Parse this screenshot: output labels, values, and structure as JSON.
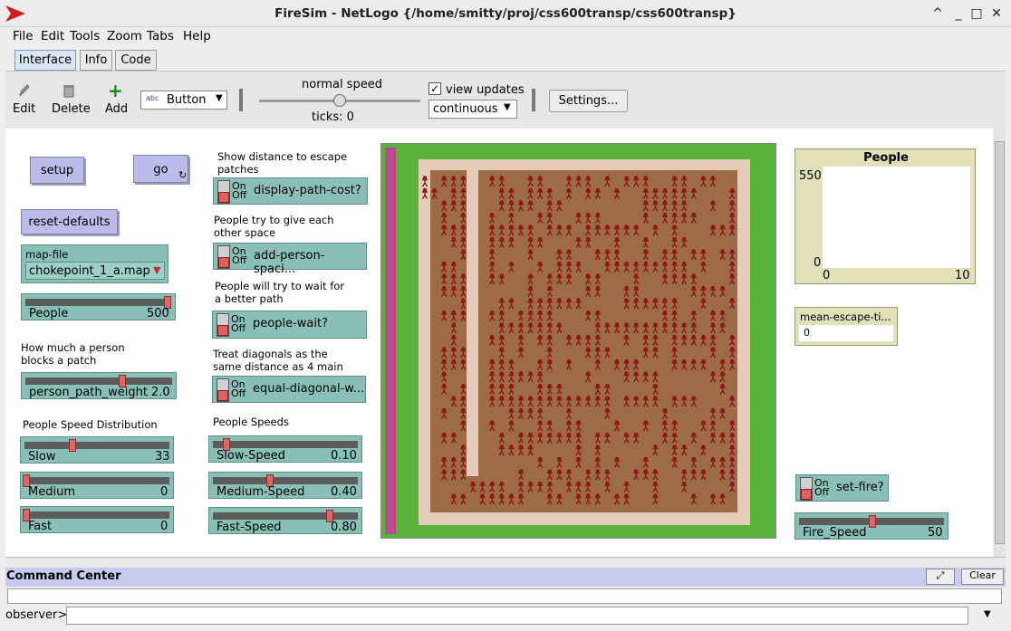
{
  "window": {
    "title": "FireSim - NetLogo {/home/smitty/proj/css600transp/css600transp}",
    "controls": [
      "^",
      "_",
      "□",
      "✕"
    ]
  },
  "menu": [
    "File",
    "Edit",
    "Tools",
    "Zoom",
    "Tabs",
    "Help"
  ],
  "tabs": [
    "Interface",
    "Info",
    "Code"
  ],
  "toolbar": {
    "edit": "Edit",
    "delete": "Delete",
    "add": "Add",
    "widget_select": "Button",
    "speed_label": "normal speed",
    "ticks": "ticks: 0",
    "view_updates": "view updates",
    "update_mode": "continuous",
    "settings": "Settings..."
  },
  "widgets": {
    "setup": "setup",
    "go": "go",
    "reset_defaults": "reset-defaults",
    "map_file": {
      "label": "map-file",
      "value": "chokepoint_1_a.map"
    },
    "people": {
      "label": "People",
      "value": "500",
      "fraction": 1.0
    },
    "note_block": "How much a person blocks a patch",
    "person_path_weight": {
      "label": "person_path_weight",
      "value": "2.0",
      "fraction": 0.66
    },
    "note_dist": "People Speed Distribution",
    "slow": {
      "label": "Slow",
      "value": "33",
      "fraction": 0.33
    },
    "medium": {
      "label": "Medium",
      "value": "0",
      "fraction": 0.0
    },
    "fast": {
      "label": "Fast",
      "value": "0",
      "fraction": 0.0
    },
    "note_escape": "Show distance to escape patches",
    "display_path_cost": "display-path-cost?",
    "note_space": "People try to give each other space",
    "add_person_spacing": "add-person-spaci...",
    "note_wait": "People will try to wait for a better path",
    "people_wait": "people-wait?",
    "note_diag": "Treat diagonals as the same distance as 4 main",
    "equal_diagonal": "equal-diagonal-w...",
    "note_speeds": "People Speeds",
    "slow_speed": {
      "label": "Slow-Speed",
      "value": "0.10",
      "fraction": 0.1
    },
    "medium_speed": {
      "label": "Medium-Speed",
      "value": "0.40",
      "fraction": 0.4
    },
    "fast_speed": {
      "label": "Fast-Speed",
      "value": "0.80",
      "fraction": 0.8
    },
    "on": "On",
    "off": "Off",
    "plot": {
      "title": "People",
      "ymax": "550",
      "ymin": "0",
      "xmin": "0",
      "xmax": "10"
    },
    "mean_escape": {
      "label": "mean-escape-ti...",
      "value": "0"
    },
    "set_fire": "set-fire?",
    "fire_speed": {
      "label": "Fire_Speed",
      "value": "50",
      "fraction": 0.5
    }
  },
  "command_center": {
    "title": "Command Center",
    "clear": "Clear",
    "prompt": "observer>"
  },
  "colors": {
    "green": "#59b33b",
    "brown": "#9d6b45",
    "wall": "#e4cbb8",
    "person": "#8e1717",
    "magenta": "#b64c8c"
  }
}
